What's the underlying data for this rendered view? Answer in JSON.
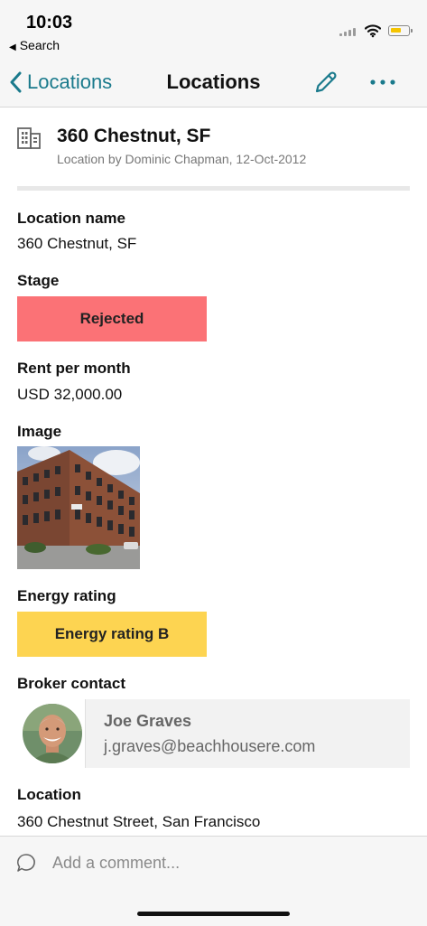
{
  "status_bar": {
    "time": "10:03",
    "back_app": "Search"
  },
  "nav": {
    "back_label": "Locations",
    "title": "Locations"
  },
  "record": {
    "title": "360 Chestnut, SF",
    "subtitle": "Location by Dominic Chapman, 12-Oct-2012"
  },
  "fields": {
    "location_name": {
      "label": "Location name",
      "value": "360 Chestnut, SF"
    },
    "stage": {
      "label": "Stage",
      "value": "Rejected",
      "color": "#fb7276"
    },
    "rent": {
      "label": "Rent per month",
      "value": "USD 32,000.00"
    },
    "image": {
      "label": "Image"
    },
    "energy": {
      "label": "Energy rating",
      "value": "Energy rating B",
      "color": "#fdd451"
    },
    "broker": {
      "label": "Broker contact",
      "name": "Joe Graves",
      "email": "j.graves@beachhousere.com"
    },
    "location": {
      "label": "Location",
      "value": "360 Chestnut Street, San Francisco"
    }
  },
  "comment": {
    "placeholder": "Add a comment..."
  },
  "colors": {
    "accent": "#1a7a8c"
  },
  "icons": [
    "back-chevron-icon",
    "edit-pencil-icon",
    "more-icon",
    "building-icon",
    "comment-bubble-icon"
  ]
}
